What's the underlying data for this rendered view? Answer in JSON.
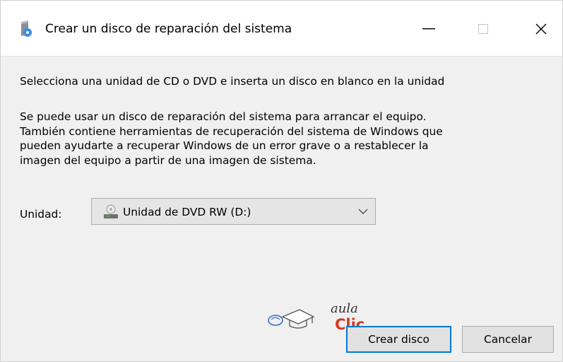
{
  "window": {
    "title": "Crear un disco de reparación del sistema",
    "icon": "disc-repair-icon",
    "controls": {
      "minimize": "minimize-icon",
      "maximize": "maximize-icon",
      "close": "close-icon"
    }
  },
  "main": {
    "instruction": "Selecciona una unidad de CD o DVD e inserta un disco en blanco en la unidad",
    "description_lines": [
      "Se puede usar un disco de reparación del sistema para arrancar el equipo.",
      "También contiene herramientas de recuperación del sistema de Windows que",
      "pueden ayudarte a recuperar Windows de un error grave o a restablecer la",
      "imagen del equipo a partir de una imagen de sistema."
    ],
    "unit_label": "Unidad:",
    "drive_select": {
      "value": "Unidad de DVD RW (D:)",
      "icon": "dvd-drive-icon"
    }
  },
  "watermark": {
    "line1": "aula",
    "line2": "Clic",
    "color": "#d9381e"
  },
  "buttons": {
    "create": "Crear disco",
    "cancel": "Cancelar"
  },
  "colors": {
    "accent": "#0078d7",
    "background": "#f0f0f0",
    "titlebar": "#ffffff"
  }
}
